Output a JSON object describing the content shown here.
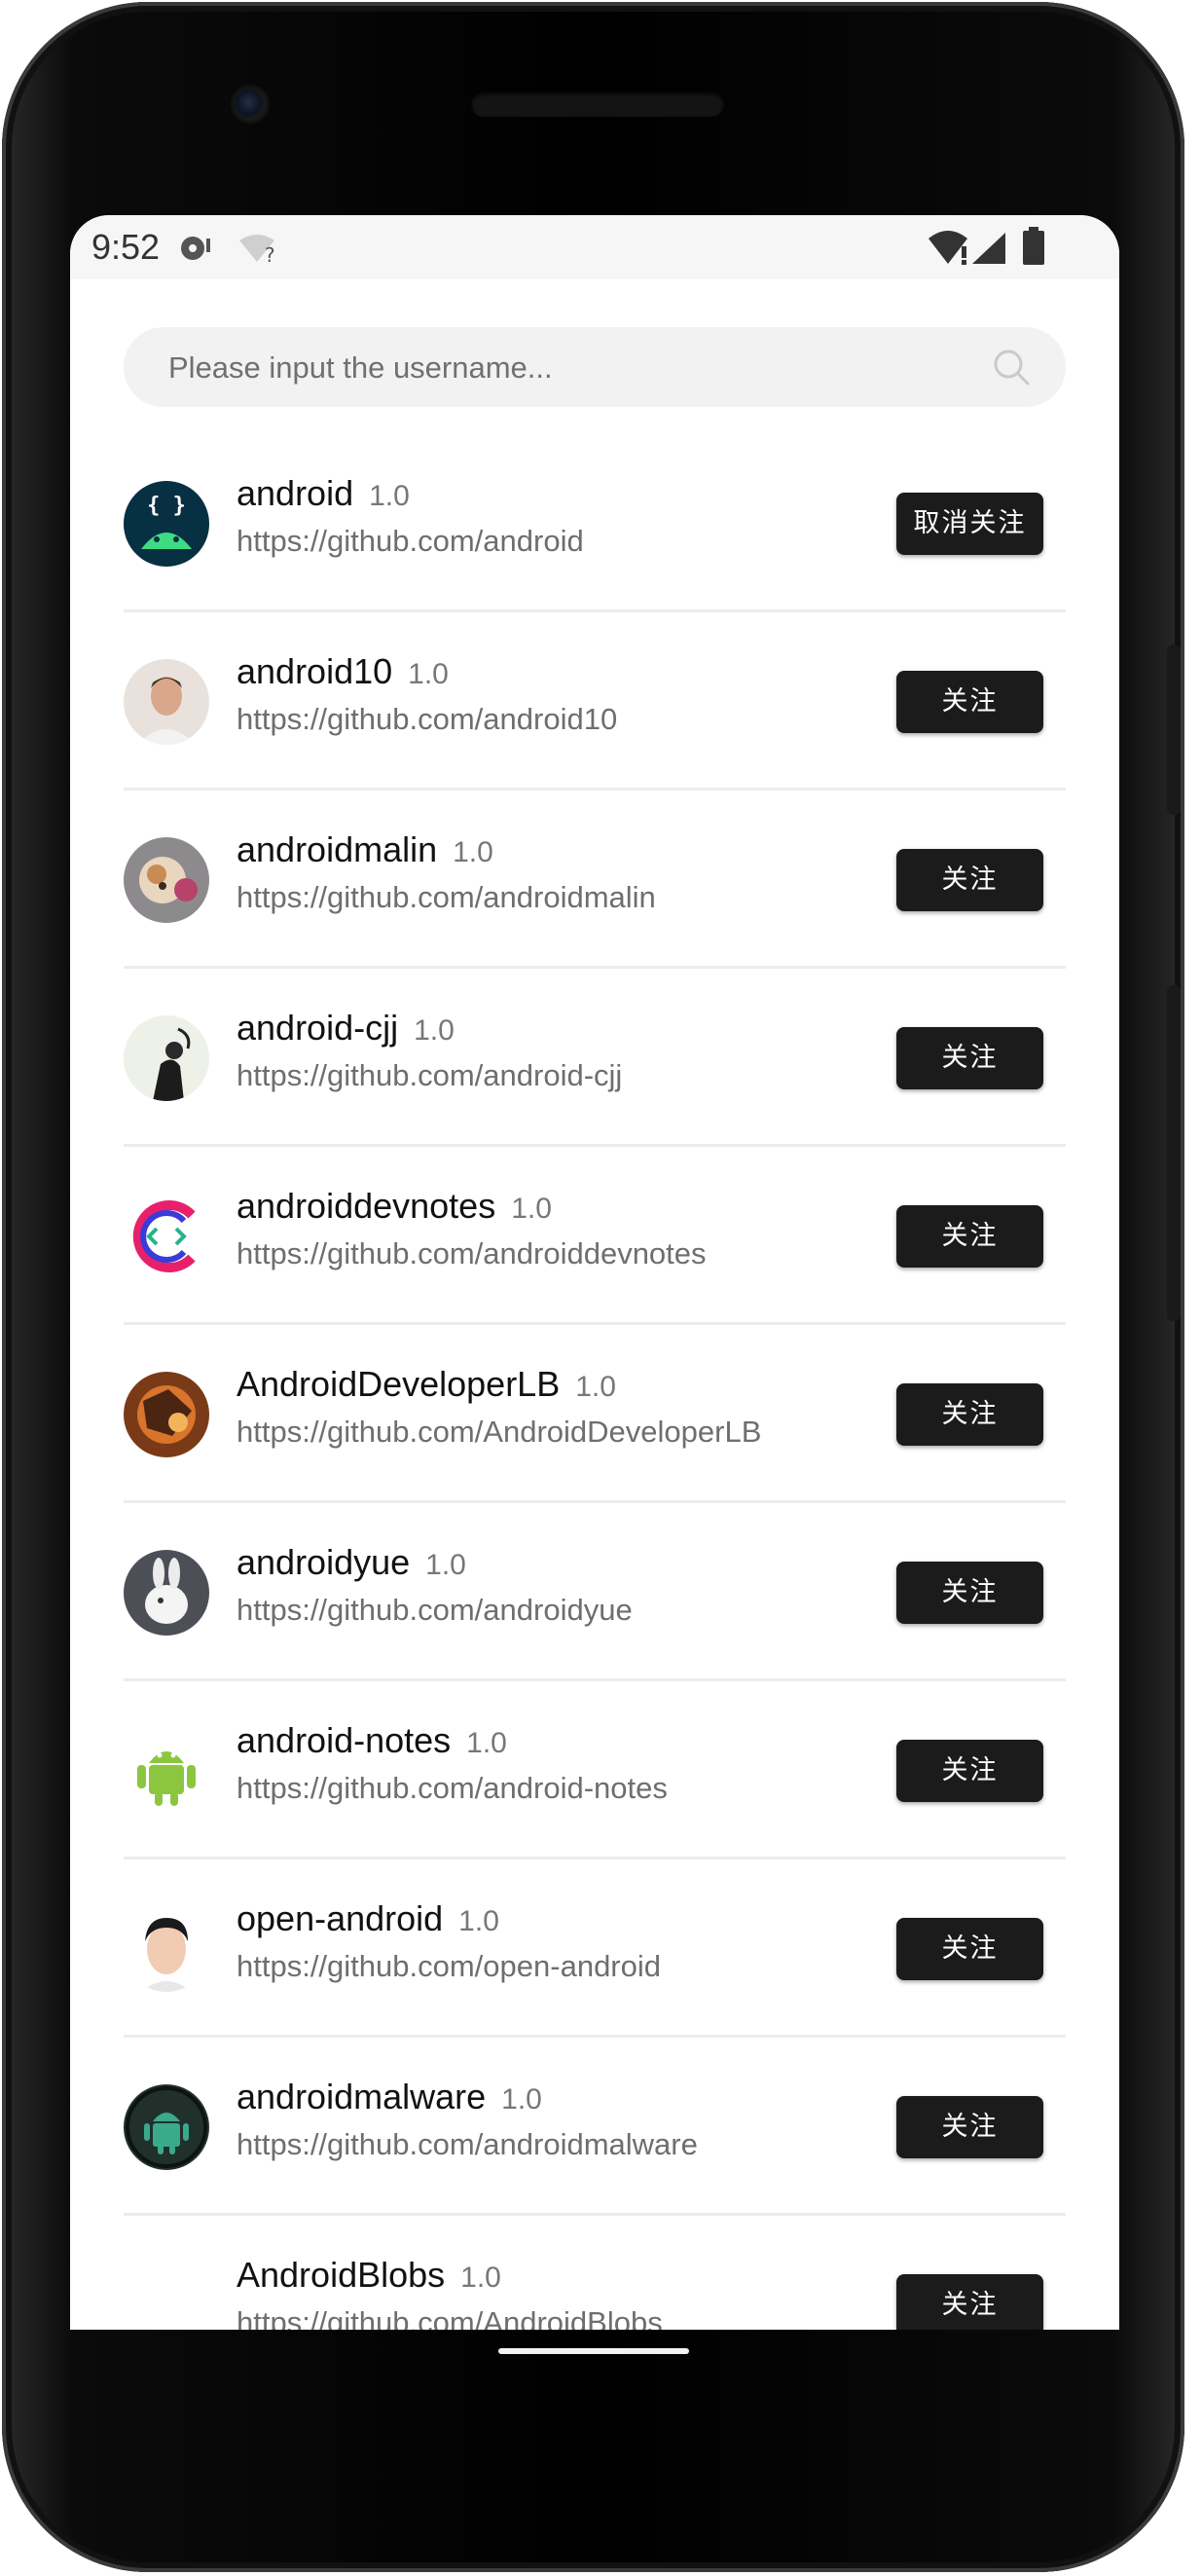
{
  "status_bar": {
    "time": "9:52",
    "icons": [
      "media-icon",
      "wifi-unknown-icon",
      "wifi-icon",
      "signal-icon",
      "battery-icon"
    ]
  },
  "search": {
    "placeholder": "Please input the username...",
    "value": ""
  },
  "users": [
    {
      "name": "android",
      "version": "1.0",
      "url": "https://github.com/android",
      "button": "取消关注",
      "avatar": "android-logo-avatar"
    },
    {
      "name": "android10",
      "version": "1.0",
      "url": "https://github.com/android10",
      "button": "关注",
      "avatar": "man-photo-avatar"
    },
    {
      "name": "androidmalin",
      "version": "1.0",
      "url": "https://github.com/androidmalin",
      "button": "关注",
      "avatar": "dog-photo-avatar"
    },
    {
      "name": "android-cjj",
      "version": "1.0",
      "url": "https://github.com/android-cjj",
      "button": "关注",
      "avatar": "sketch-avatar"
    },
    {
      "name": "androiddevnotes",
      "version": "1.0",
      "url": "https://github.com/androiddevnotes",
      "button": "关注",
      "avatar": "code-logo-avatar"
    },
    {
      "name": "AndroidDeveloperLB",
      "version": "1.0",
      "url": "https://github.com/AndroidDeveloperLB",
      "button": "关注",
      "avatar": "fantasy-art-avatar"
    },
    {
      "name": "androidyue",
      "version": "1.0",
      "url": "https://github.com/androidyue",
      "button": "关注",
      "avatar": "rabbit-photo-avatar"
    },
    {
      "name": "android-notes",
      "version": "1.0",
      "url": "https://github.com/android-notes",
      "button": "关注",
      "avatar": "android-robot-avatar"
    },
    {
      "name": "open-android",
      "version": "1.0",
      "url": "https://github.com/open-android",
      "button": "关注",
      "avatar": "person-photo-avatar"
    },
    {
      "name": "androidmalware",
      "version": "1.0",
      "url": "https://github.com/androidmalware",
      "button": "关注",
      "avatar": "android-green-avatar"
    },
    {
      "name": "AndroidBlobs",
      "version": "1.0",
      "url": "https://github.com/AndroidBlobs",
      "button": "关注",
      "avatar": "blank-avatar"
    }
  ]
}
